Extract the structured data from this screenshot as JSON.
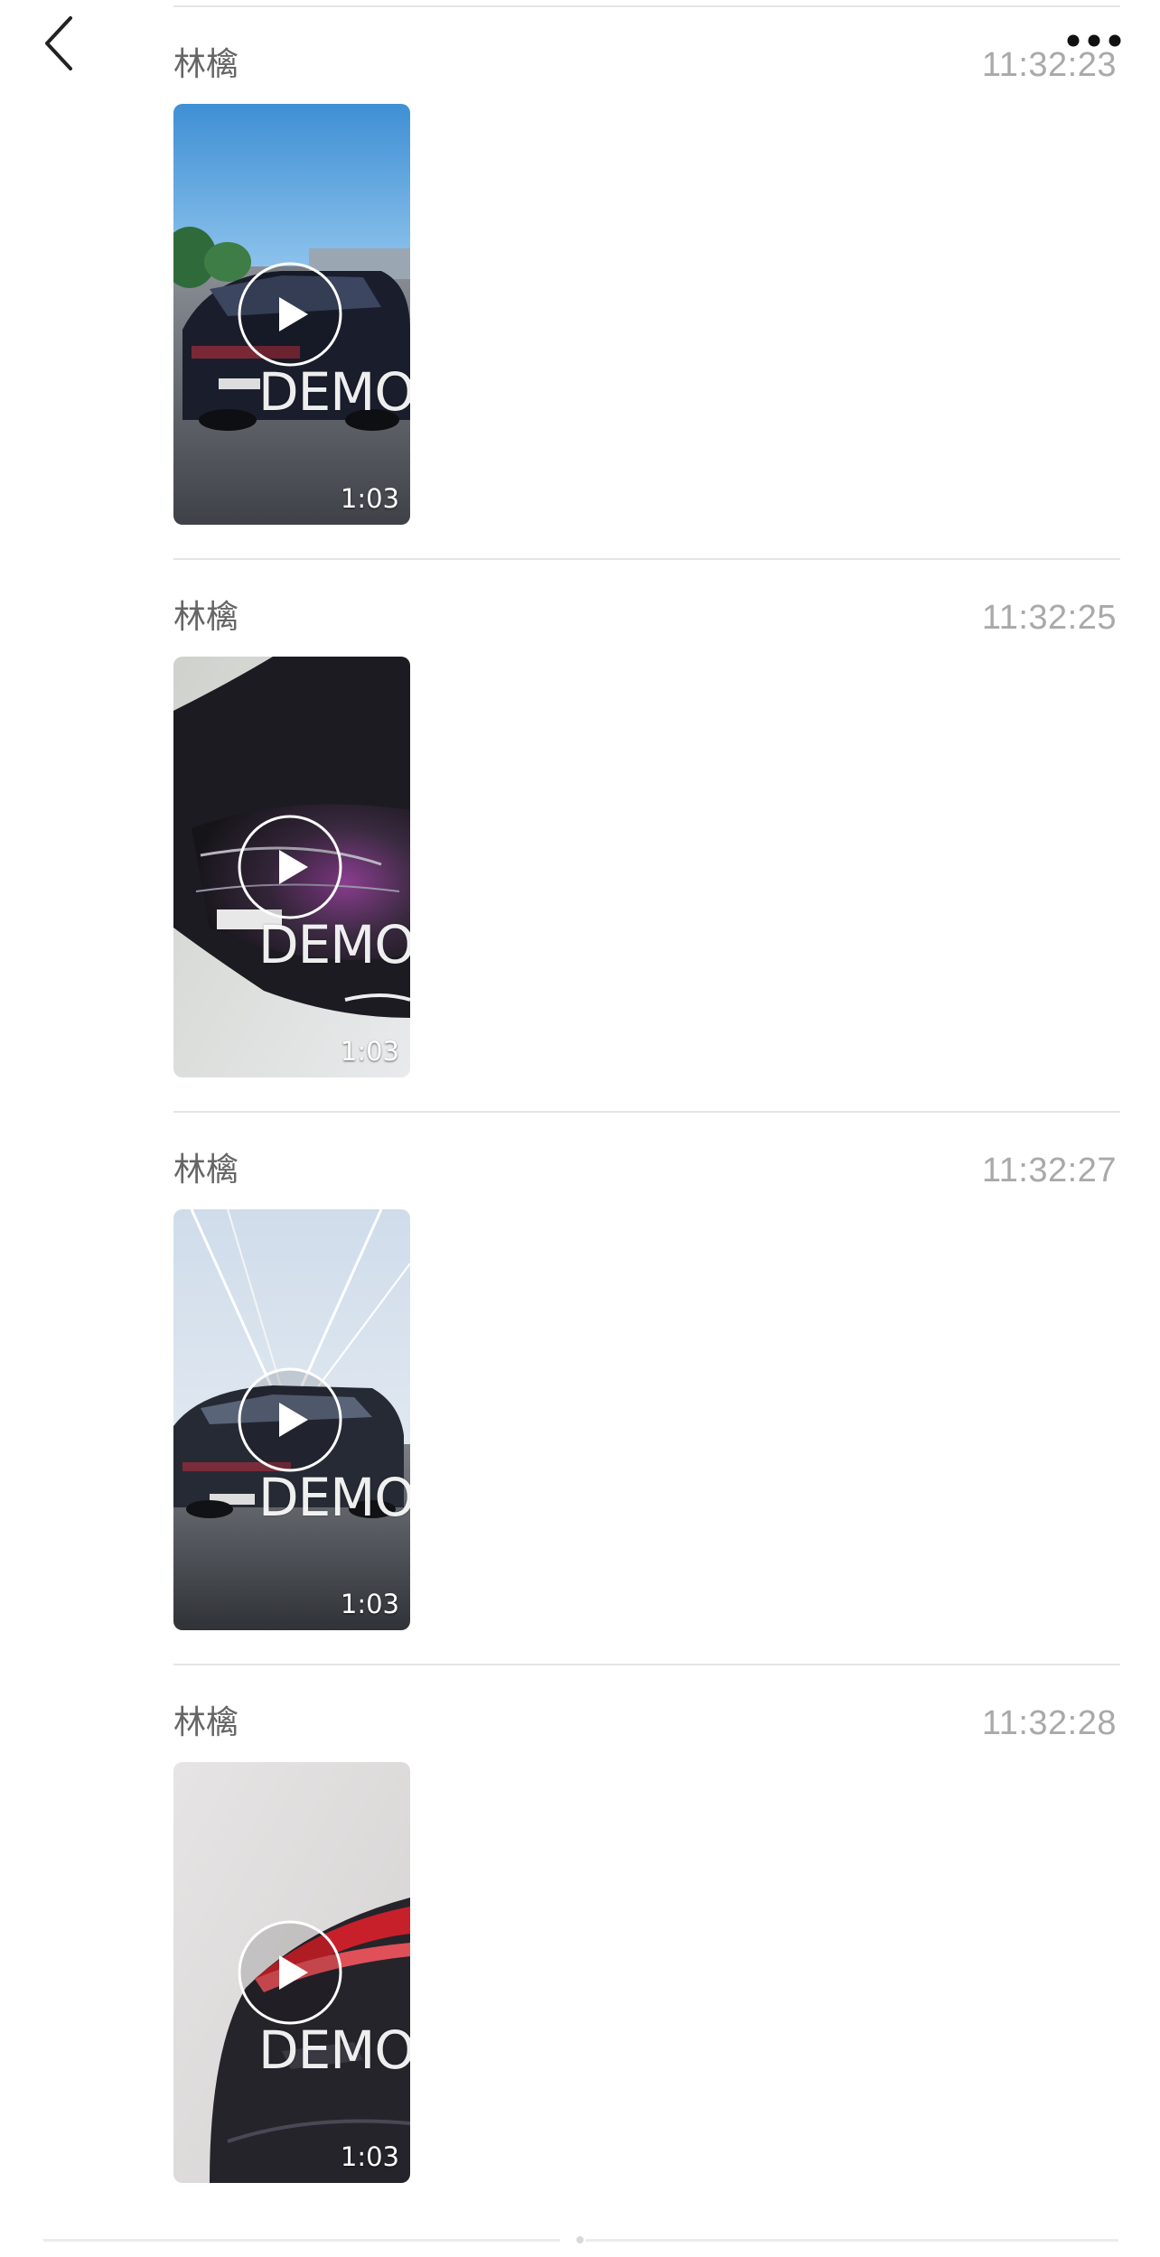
{
  "nav": {
    "back_icon": "chevron-left-icon",
    "more_icon": "ellipsis-icon"
  },
  "messages": [
    {
      "sender": "林檎",
      "time": "11:32:23",
      "watermark": "DEMO",
      "duration": "1:03",
      "play_icon": "play-icon"
    },
    {
      "sender": "林檎",
      "time": "11:32:25",
      "watermark": "DEMO",
      "duration": "1:03",
      "play_icon": "play-icon"
    },
    {
      "sender": "林檎",
      "time": "11:32:27",
      "watermark": "DEMO",
      "duration": "1:03",
      "play_icon": "play-icon"
    },
    {
      "sender": "林檎",
      "time": "11:32:28",
      "watermark": "DEMO",
      "duration": "1:03",
      "play_icon": "play-icon"
    }
  ],
  "colors": {
    "sender_text": "#666666",
    "time_text": "#a9a9a9",
    "divider": "#e5e5e5"
  }
}
